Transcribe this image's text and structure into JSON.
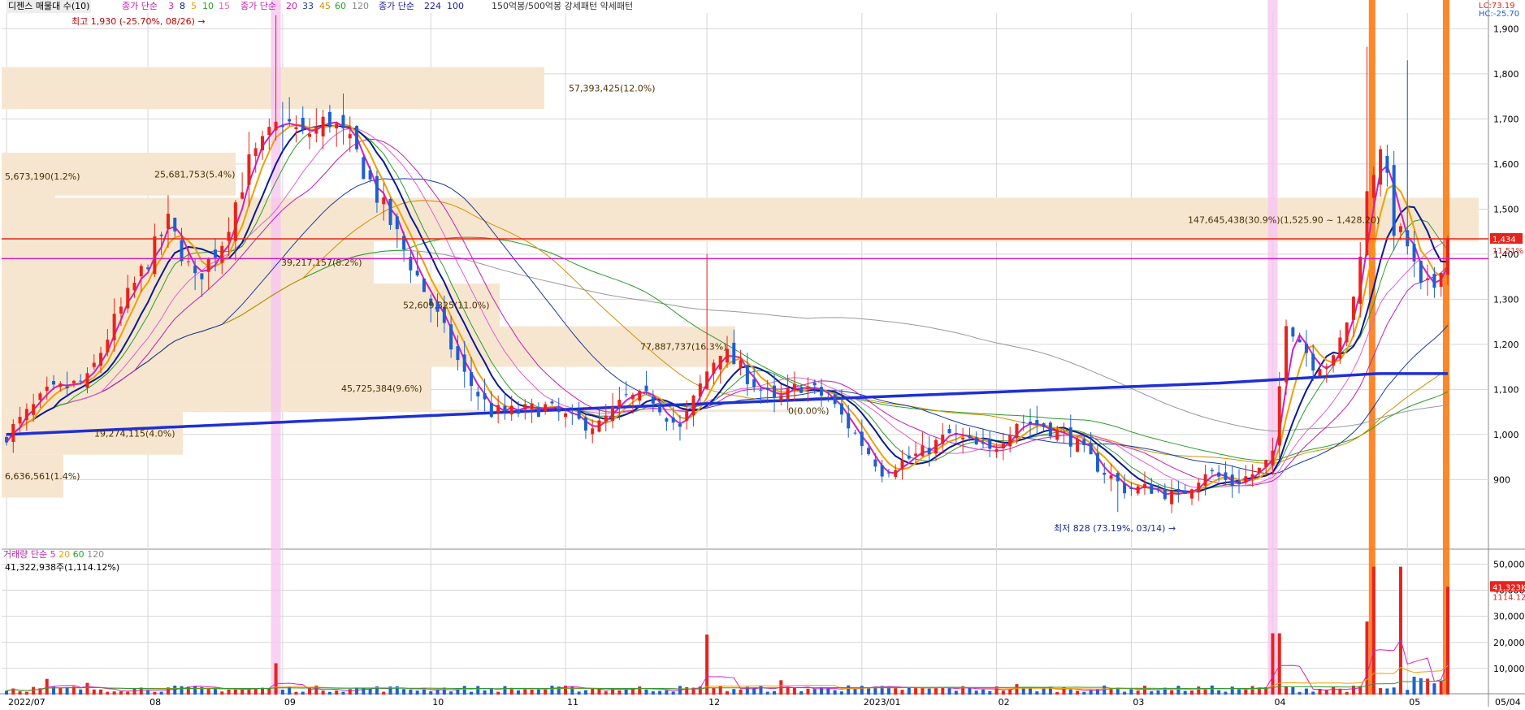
{
  "header": {
    "title": "디젠스 매물대 수(10)",
    "ma_price_label": "종가 단순",
    "ma_price_periods_short": [
      "3",
      "8",
      "5",
      "10",
      "15"
    ],
    "ma_price_label2": "종가 단순",
    "ma_price_periods_mid": [
      "20",
      "33",
      "45",
      "60",
      "120"
    ],
    "ma_price_label3": "종가 단순",
    "ma_price_periods_long": [
      "224",
      "100"
    ],
    "pattern_label": "150억봉/500억봉 강세패턴  약세패턴",
    "lc_label": "LC:73.19",
    "hc_label": "HC:-25.70"
  },
  "volume_header": {
    "label": "거래량",
    "ma_label": "단순",
    "periods": [
      "5",
      "20",
      "60",
      "120"
    ],
    "current_text": "41,322,938주(1,114.12%)"
  },
  "annotations": {
    "high": "최고 1,930 (-25.70%, 08/26)",
    "low": "최저 828 (73.19%, 03/14)",
    "price_tag": "1,434",
    "pct_tag": "11.51%",
    "vol_tag": "41,323K",
    "vol_pct_tag": "1114.12%"
  },
  "colors": {
    "up": "#e8231b",
    "down": "#1d5fd0",
    "zone": "#f6e6d0",
    "ma224": "#1f2fd6",
    "grid": "#d6d6d6",
    "highlight_pink": "#f7c6f0",
    "highlight_orange": "#ff7a10"
  },
  "chart_data": [
    {
      "type": "candlestick",
      "title": "",
      "x_ticks": [
        "2022/07",
        "08",
        "09",
        "10",
        "11",
        "12",
        "2023/01",
        "02",
        "03",
        "04",
        "05",
        "05/04"
      ],
      "y_ticks": [
        "1,900",
        "1,800",
        "1,700",
        "1,600",
        "1,500",
        "1,400",
        "1,300",
        "1,200",
        "1,100",
        "1,000",
        "900"
      ],
      "ylim": [
        760,
        1935
      ],
      "grid": true,
      "key_points": [
        {
          "date": "2022/07",
          "close": 1000
        },
        {
          "date": "08/26",
          "high": 1930
        },
        {
          "date": "2023/03/14",
          "low": 828
        },
        {
          "date": "05/04",
          "close": 1434
        }
      ],
      "volume_profile": [
        {
          "label": "57,393,425(12.0%)"
        },
        {
          "label": "25,681,753(5.4%)"
        },
        {
          "label": "5,673,190(1.2%)"
        },
        {
          "label": "147,645,438(30.9%)(1,525.90 ~ 1,428.20)"
        },
        {
          "label": "39,217,157(8.2%)"
        },
        {
          "label": "52,609,325(11.0%)"
        },
        {
          "label": "77,887,737(16.3%)"
        },
        {
          "label": "45,725,384(9.6%)"
        },
        {
          "label": "0(0.00%)"
        },
        {
          "label": "19,274,115(4.0%)"
        },
        {
          "label": "6,636,561(1.4%)"
        }
      ],
      "series": [
        {
          "name": "224",
          "color": "#1f2fd6"
        },
        {
          "name": "3",
          "color": "#d020c0"
        },
        {
          "name": "5",
          "color": "#f0a000"
        },
        {
          "name": "8",
          "color": "#0a1a90"
        }
      ]
    },
    {
      "type": "bar",
      "title": "",
      "y_ticks": [
        "50,000K",
        "40,000K",
        "30,000K",
        "20,000K",
        "10,000K"
      ],
      "ylim": [
        0,
        52000
      ],
      "notable_values_K": [
        {
          "date": "08/26",
          "value": 12000
        },
        {
          "date": "11/30",
          "value": 23000
        },
        {
          "date": "04/03",
          "value": 23500
        },
        {
          "date": "04/24",
          "value": 49000
        },
        {
          "date": "05/04",
          "value": 41323
        }
      ]
    }
  ]
}
